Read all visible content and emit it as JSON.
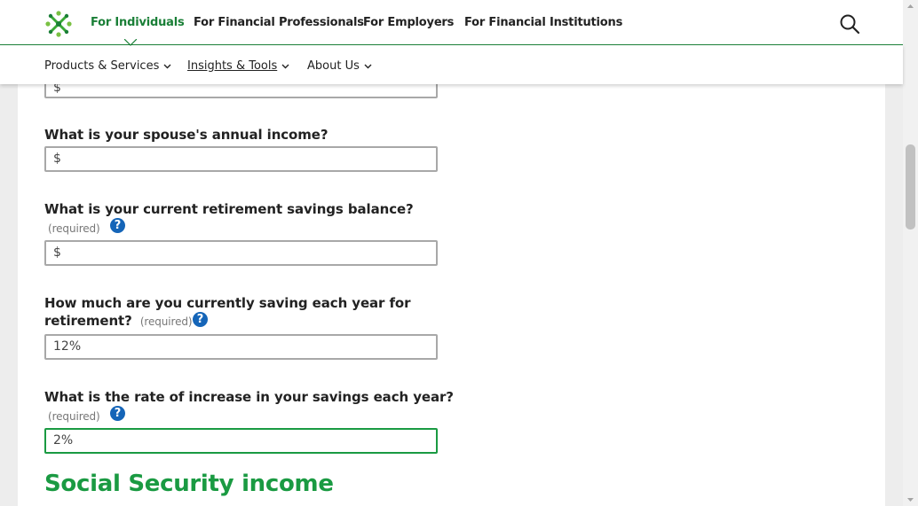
{
  "top_nav": {
    "items": [
      {
        "label": "For Individuals",
        "active": true
      },
      {
        "label": "For Financial Professionals"
      },
      {
        "label": "For Employers"
      },
      {
        "label": "For Financial Institutions"
      }
    ],
    "search_icon": "search-icon",
    "brand_color": "#1a7f37"
  },
  "sub_nav": {
    "items": [
      {
        "label": "Products & Services"
      },
      {
        "label": "Insights & Tools"
      },
      {
        "label": "About Us"
      }
    ]
  },
  "form": {
    "prev_field_prefix": "$",
    "spouse_income": {
      "question": "What is your spouse's annual income?",
      "prefix": "$"
    },
    "savings_balance": {
      "question": "What is your current retirement savings balance?",
      "required": "(required)",
      "prefix": "$"
    },
    "annual_saving": {
      "question_line1": "How much are you currently saving each year for",
      "question_line2": "retirement?",
      "required": "(required)",
      "value": "12%"
    },
    "rate_increase": {
      "question": "What is the rate of increase in your savings each year?",
      "required": "(required)",
      "value": "2%"
    },
    "help_glyph": "?"
  },
  "section": {
    "title": "Social Security income"
  },
  "colors": {
    "accent": "#1a9a42",
    "help": "#1565b8"
  }
}
